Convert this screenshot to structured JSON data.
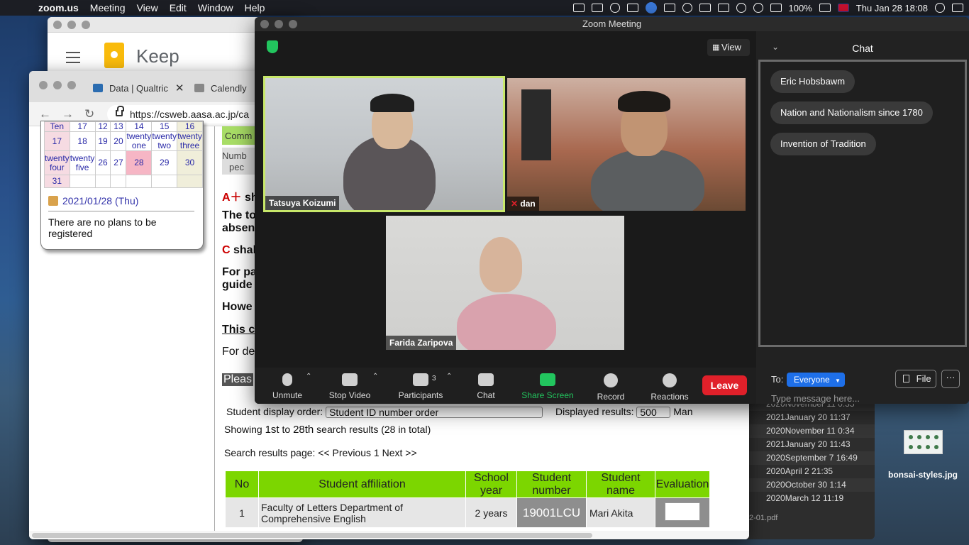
{
  "menubar": {
    "app": "zoom.us",
    "items": [
      "Meeting",
      "View",
      "Edit",
      "Window",
      "Help"
    ],
    "battery": "100%",
    "datetime": "Thu Jan 28  18:08"
  },
  "keep": {
    "title": "Keep"
  },
  "browser": {
    "tabs": [
      {
        "label": "Data | Qualtric"
      },
      {
        "label": "Calendly"
      }
    ],
    "url": "https://csweb.aasa.ac.jp/ca",
    "calendar": {
      "rows": [
        [
          "Ten",
          "17",
          "12",
          "13",
          "14",
          "15",
          "16"
        ],
        [
          "17",
          "18",
          "19",
          "20",
          "twenty one",
          "twenty two",
          "twenty three"
        ],
        [
          "twenty four",
          "twenty five",
          "26",
          "27",
          "28",
          "29",
          "30"
        ],
        [
          "31",
          "",
          "",
          "",
          "",
          "",
          ""
        ]
      ],
      "selected_date": "2021/01/28 (Thu)",
      "no_plans": "There are no plans to be registered"
    },
    "content": {
      "comm": "Comm",
      "numb": "Numb",
      "pec": "pec",
      "a_plus_prefix": "A＋",
      "a_plus_text": " sh",
      "the_to": "The to",
      "absen": "absen",
      "c_prefix": "C",
      "c_text": " shal",
      "for_pa": "For pa",
      "guide": "guide",
      "howe": "Howe",
      "this_c": "This c",
      "for_de": "For de",
      "pleas": "Pleas",
      "display_order_label": "Student display order:",
      "display_order_value": "Student ID number order",
      "displayed_results_label": "Displayed results:",
      "displayed_results_value": "500",
      "man": "Man",
      "showing": "Showing",
      "first": "1st",
      "to": "to",
      "last": "28th",
      "search_results": "search results (28 in total)",
      "results_page": "Search results page: << Previous",
      "page": "1",
      "next": "Next >>"
    },
    "table": {
      "headers": [
        "No",
        "Student affiliation",
        "School year",
        "Student number",
        "Student name",
        "Evaluation"
      ],
      "rows": [
        [
          "1",
          "Faculty of Letters Department of Comprehensive English",
          "2 years",
          "19001LCU",
          "Mari Akita",
          ""
        ]
      ]
    }
  },
  "finder": {
    "rows": [
      "2020November 11 0:35",
      "2021January 20 11:37",
      "2020November 11 0:34",
      "2021January 20 11:43",
      "2020September 7 16:49",
      "2020April 2 21:35",
      "2020October 30 1:14",
      "2020March 12 11:19"
    ],
    "pdf_name": "2-01.pdf"
  },
  "desktop_icon": {
    "label": "bonsai-styles.jpg"
  },
  "zoom": {
    "title": "Zoom Meeting",
    "view_label": "View",
    "participants": [
      {
        "name": "Tatsuya Koizumi"
      },
      {
        "name": "dan"
      },
      {
        "name": "Farida Zaripova"
      }
    ],
    "toolbar": {
      "unmute": "Unmute",
      "stop_video": "Stop Video",
      "participants": "Participants",
      "participants_count": "3",
      "chat": "Chat",
      "share_screen": "Share Screen",
      "record": "Record",
      "reactions": "Reactions",
      "leave": "Leave"
    },
    "chat": {
      "title": "Chat",
      "messages": [
        "Eric Hobsbawm",
        "Nation and Nationalism since 1780",
        "Invention of Tradition"
      ],
      "to_label": "To:",
      "recipient": "Everyone",
      "file_label": "File",
      "more_label": "···",
      "placeholder": "Type message here..."
    },
    "colors": {
      "leave": "#e0202a",
      "share": "#22c55e",
      "everyone": "#1e6fe8",
      "speaker_border": "#c8e86a"
    }
  }
}
